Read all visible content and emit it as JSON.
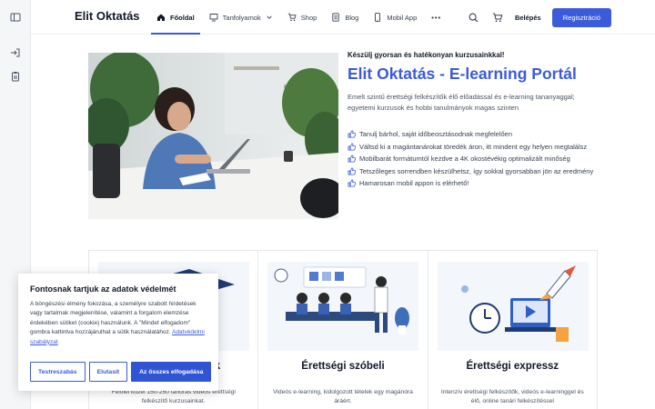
{
  "header": {
    "brand": "Elit Oktatás",
    "nav": [
      {
        "label": "Főoldal",
        "icon": "home-icon"
      },
      {
        "label": "Tanfolyamok",
        "icon": "screen-icon"
      },
      {
        "label": "Shop",
        "icon": "cart-icon"
      },
      {
        "label": "Blog",
        "icon": "document-icon"
      },
      {
        "label": "Mobil App",
        "icon": "phone-icon"
      }
    ],
    "more": "•••",
    "login": "Belépés",
    "signup": "Regisztráció"
  },
  "hero": {
    "tagline": "Készülj gyorsan és hatékonyan kurzusainkkal!",
    "title": "Elit Oktatás - E-learning Portál",
    "description": "Emelt szintű érettségi felkészítők élő előadással és e-learning tananyaggal; egyetemi kurzusok és hobbi tanulmányok magas szinten",
    "features": [
      "Tanulj bárhol, saját időbeosztásodnak megfelelően",
      "Váltsd ki a magántanárokat töredék áron, itt mindent egy helyen megtalálsz",
      "Mobilbarát formátumtól kezdve a 4K okostévékig optimalizált minőség",
      "Tetszőleges sorrendben készülhetsz, így sokkal gyorsabban jön az eredmény",
      "Hamarosan mobil appon is elérhető!"
    ]
  },
  "cards": [
    {
      "title": "Érettségi kurzusok",
      "description": "Felölel közel 150-250 tanórás videós érettségi felkészítő kurzusainkat."
    },
    {
      "title": "Érettségi szóbeli",
      "description": "Videós e-learning, kidolgozott tételek egy magánóra áráért."
    },
    {
      "title": "Érettségi expressz",
      "description": "Intenzív érettségi felkészítők, videós e-learninggel és élő, online tanári felkészítéssel"
    }
  ],
  "cookie": {
    "title": "Fontosnak tartjuk az adatok védelmét",
    "text": "A böngészési élmény fokozása, a személyre szabott hirdetések vagy tartalmak megjelenítése, valamint a forgalom elemzése érdekében sütiket (cookie) használunk. A \"Mindet elfogadom\" gombra kattintva hozzájárulhat a sütik használatához.",
    "link": "Adatvédelmi szabályzat",
    "buttons": {
      "customize": "Testreszabás",
      "reject": "Elutasít",
      "accept": "Az összes elfogadása"
    }
  },
  "colors": {
    "accent": "#3b5bdb",
    "rail": "#f4f6f8"
  }
}
